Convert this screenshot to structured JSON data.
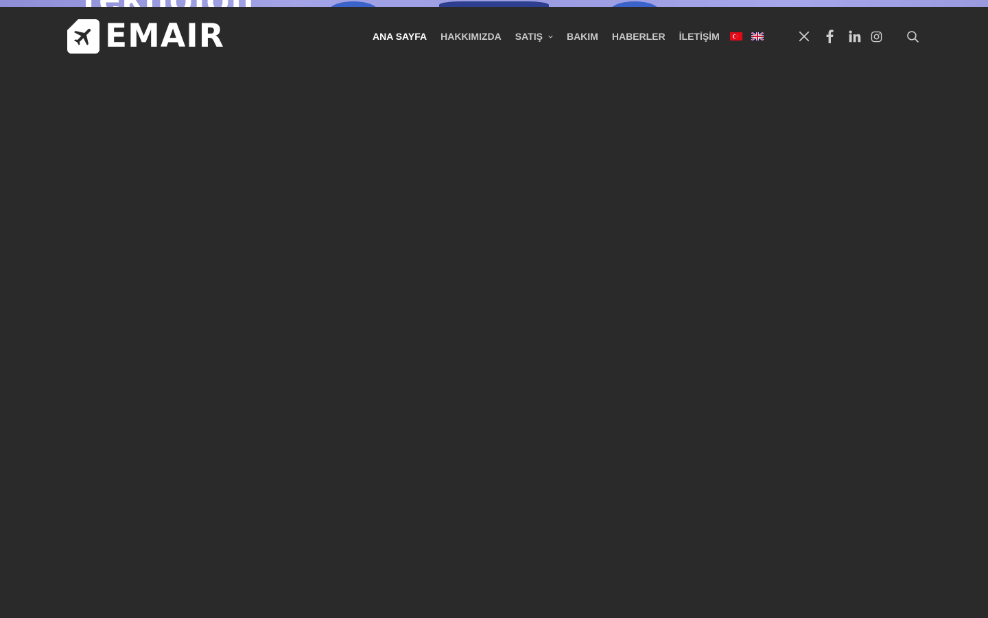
{
  "hero": {
    "text_fragment": "Teknoloji"
  },
  "brand": {
    "name": "EMAIR",
    "logo_icon": "airplane-icon"
  },
  "nav": {
    "items": [
      {
        "label": "ANA SAYFA",
        "active": true
      },
      {
        "label": "HAKKIMIZDA",
        "active": false
      },
      {
        "label": "SATIŞ",
        "active": false,
        "has_dropdown": true
      },
      {
        "label": "BAKIM",
        "active": false
      },
      {
        "label": "HABERLER",
        "active": false
      },
      {
        "label": "İLETİŞİM",
        "active": false
      }
    ]
  },
  "languages": [
    {
      "code": "tr",
      "icon": "turkey-flag-icon"
    },
    {
      "code": "en",
      "icon": "uk-flag-icon"
    }
  ],
  "social": [
    {
      "name": "x",
      "icon": "x-icon"
    },
    {
      "name": "facebook",
      "icon": "facebook-icon"
    },
    {
      "name": "linkedin",
      "icon": "linkedin-icon"
    },
    {
      "name": "instagram",
      "icon": "instagram-icon"
    }
  ],
  "search": {
    "icon": "search-icon"
  },
  "colors": {
    "header_bg": "#2a2a2a",
    "nav_text": "#c9c9c9",
    "nav_active": "#ffffff",
    "hero_tint": "#9c9ce2"
  }
}
